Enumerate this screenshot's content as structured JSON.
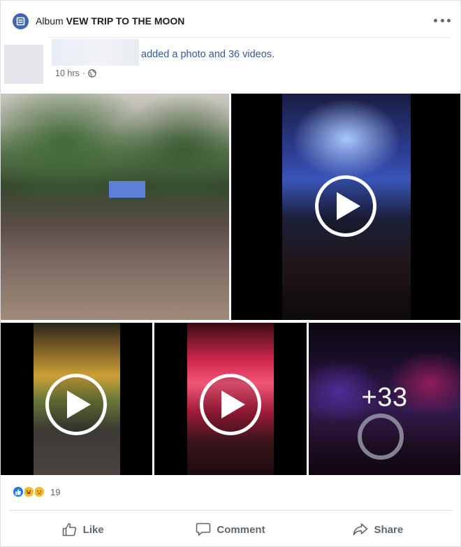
{
  "header": {
    "album_label": "Album",
    "album_name": "VEW TRIP TO THE MOON",
    "album_icon": "album-icon",
    "more_icon": "more-options-icon"
  },
  "post": {
    "action_text": "added a photo and 36 videos.",
    "timestamp": "10 hrs",
    "separator": "·",
    "privacy_icon": "globe-icon"
  },
  "media": {
    "items": [
      {
        "type": "photo"
      },
      {
        "type": "video",
        "play_icon": "play-icon"
      },
      {
        "type": "video",
        "play_icon": "play-icon"
      },
      {
        "type": "video",
        "play_icon": "play-icon"
      },
      {
        "type": "more",
        "label": "+33"
      }
    ]
  },
  "reactions": {
    "icons": [
      "like-reaction-icon",
      "haha-reaction-icon",
      "sad-reaction-icon"
    ],
    "count": "19"
  },
  "actions": {
    "like_label": "Like",
    "comment_label": "Comment",
    "share_label": "Share"
  },
  "colors": {
    "brand": "#4267b2",
    "link": "#385898",
    "secondary_text": "#606770"
  }
}
